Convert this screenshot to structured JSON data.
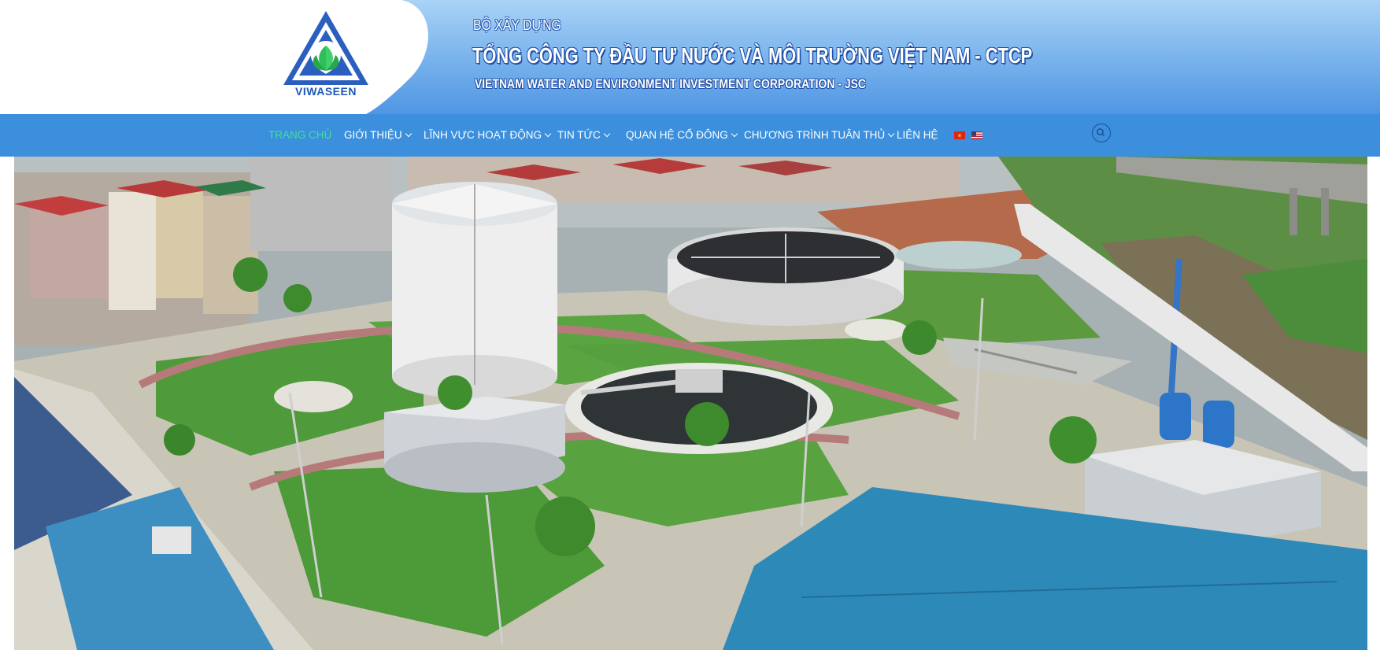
{
  "header": {
    "logo_text": "VIWASEEN",
    "ministry": "BỘ XÂY DỰNG",
    "company_name_vn": "TỔNG CÔNG TY ĐẦU TƯ NƯỚC VÀ MÔI TRƯỜNG VIỆT NAM - CTCP",
    "company_name_en": "VIETNAM WATER AND ENVIRONMENT INVESTMENT CORPORATION - JSC"
  },
  "nav": {
    "items": [
      {
        "label": "TRANG CHỦ",
        "active": true,
        "dropdown": false
      },
      {
        "label": "GIỚI THIỆU",
        "active": false,
        "dropdown": true
      },
      {
        "label": "LĨNH VỰC HOẠT ĐỘNG",
        "active": false,
        "dropdown": true
      },
      {
        "label": "TIN TỨC",
        "active": false,
        "dropdown": true
      },
      {
        "label": "QUAN HỆ CỔ ĐÔNG",
        "active": false,
        "dropdown": true
      },
      {
        "label": "CHƯƠNG TRÌNH TUÂN THỦ",
        "active": false,
        "dropdown": true
      },
      {
        "label": "LIÊN HỆ",
        "active": false,
        "dropdown": false
      }
    ],
    "languages": [
      "vietnam-flag-icon",
      "usa-flag-icon"
    ],
    "search_icon": "search-icon"
  },
  "colors": {
    "nav_bg": "#3b8fdc",
    "active_nav": "#3ee29a",
    "brand_blue": "#1f58b8"
  },
  "hero": {
    "icon": "water-treatment-plant-photo"
  }
}
